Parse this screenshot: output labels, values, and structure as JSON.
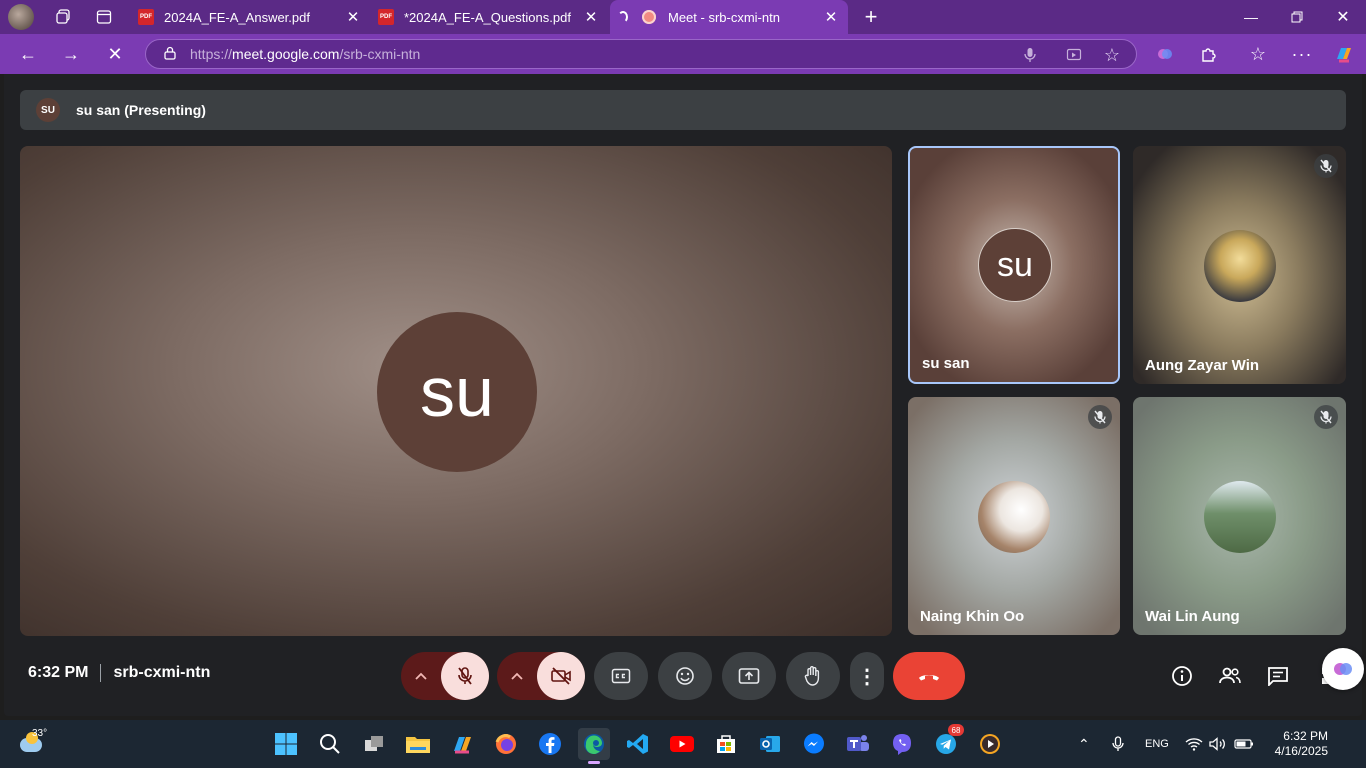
{
  "browser": {
    "tabs": [
      {
        "title": "2024A_FE-A_Answer.pdf",
        "type": "pdf"
      },
      {
        "title": "*2024A_FE-A_Questions.pdf",
        "type": "pdf"
      },
      {
        "title": "Meet - srb-cxmi-ntn",
        "type": "meet",
        "active": true
      }
    ],
    "pdf_badge": "PDF",
    "new_tab_label": "+",
    "url_prefix": "https://",
    "url_host": "meet.google.com",
    "url_path": "/srb-cxmi-ntn"
  },
  "meet": {
    "presenting_avatar": "SU",
    "presenting_text": "su san (Presenting)",
    "main_avatar": "su",
    "participants": [
      {
        "name": "su san",
        "avatar_text": "su",
        "muted": false,
        "highlighted": true
      },
      {
        "name": "Aung Zayar Win",
        "muted": true
      },
      {
        "name": "Naing Khin Oo",
        "muted": true
      },
      {
        "name": "Wai Lin Aung",
        "muted": true
      }
    ],
    "time": "6:32 PM",
    "meeting_code": "srb-cxmi-ntn",
    "colors": {
      "hangup": "#ea4335",
      "muted_bg": "#f9dedc",
      "muted_arrow_bg": "#5c1a1a"
    }
  },
  "taskbar": {
    "weather_temp": "33°",
    "telegram_badge": "68",
    "lang": "ENG",
    "clock_time": "6:32 PM",
    "clock_date": "4/16/2025"
  }
}
